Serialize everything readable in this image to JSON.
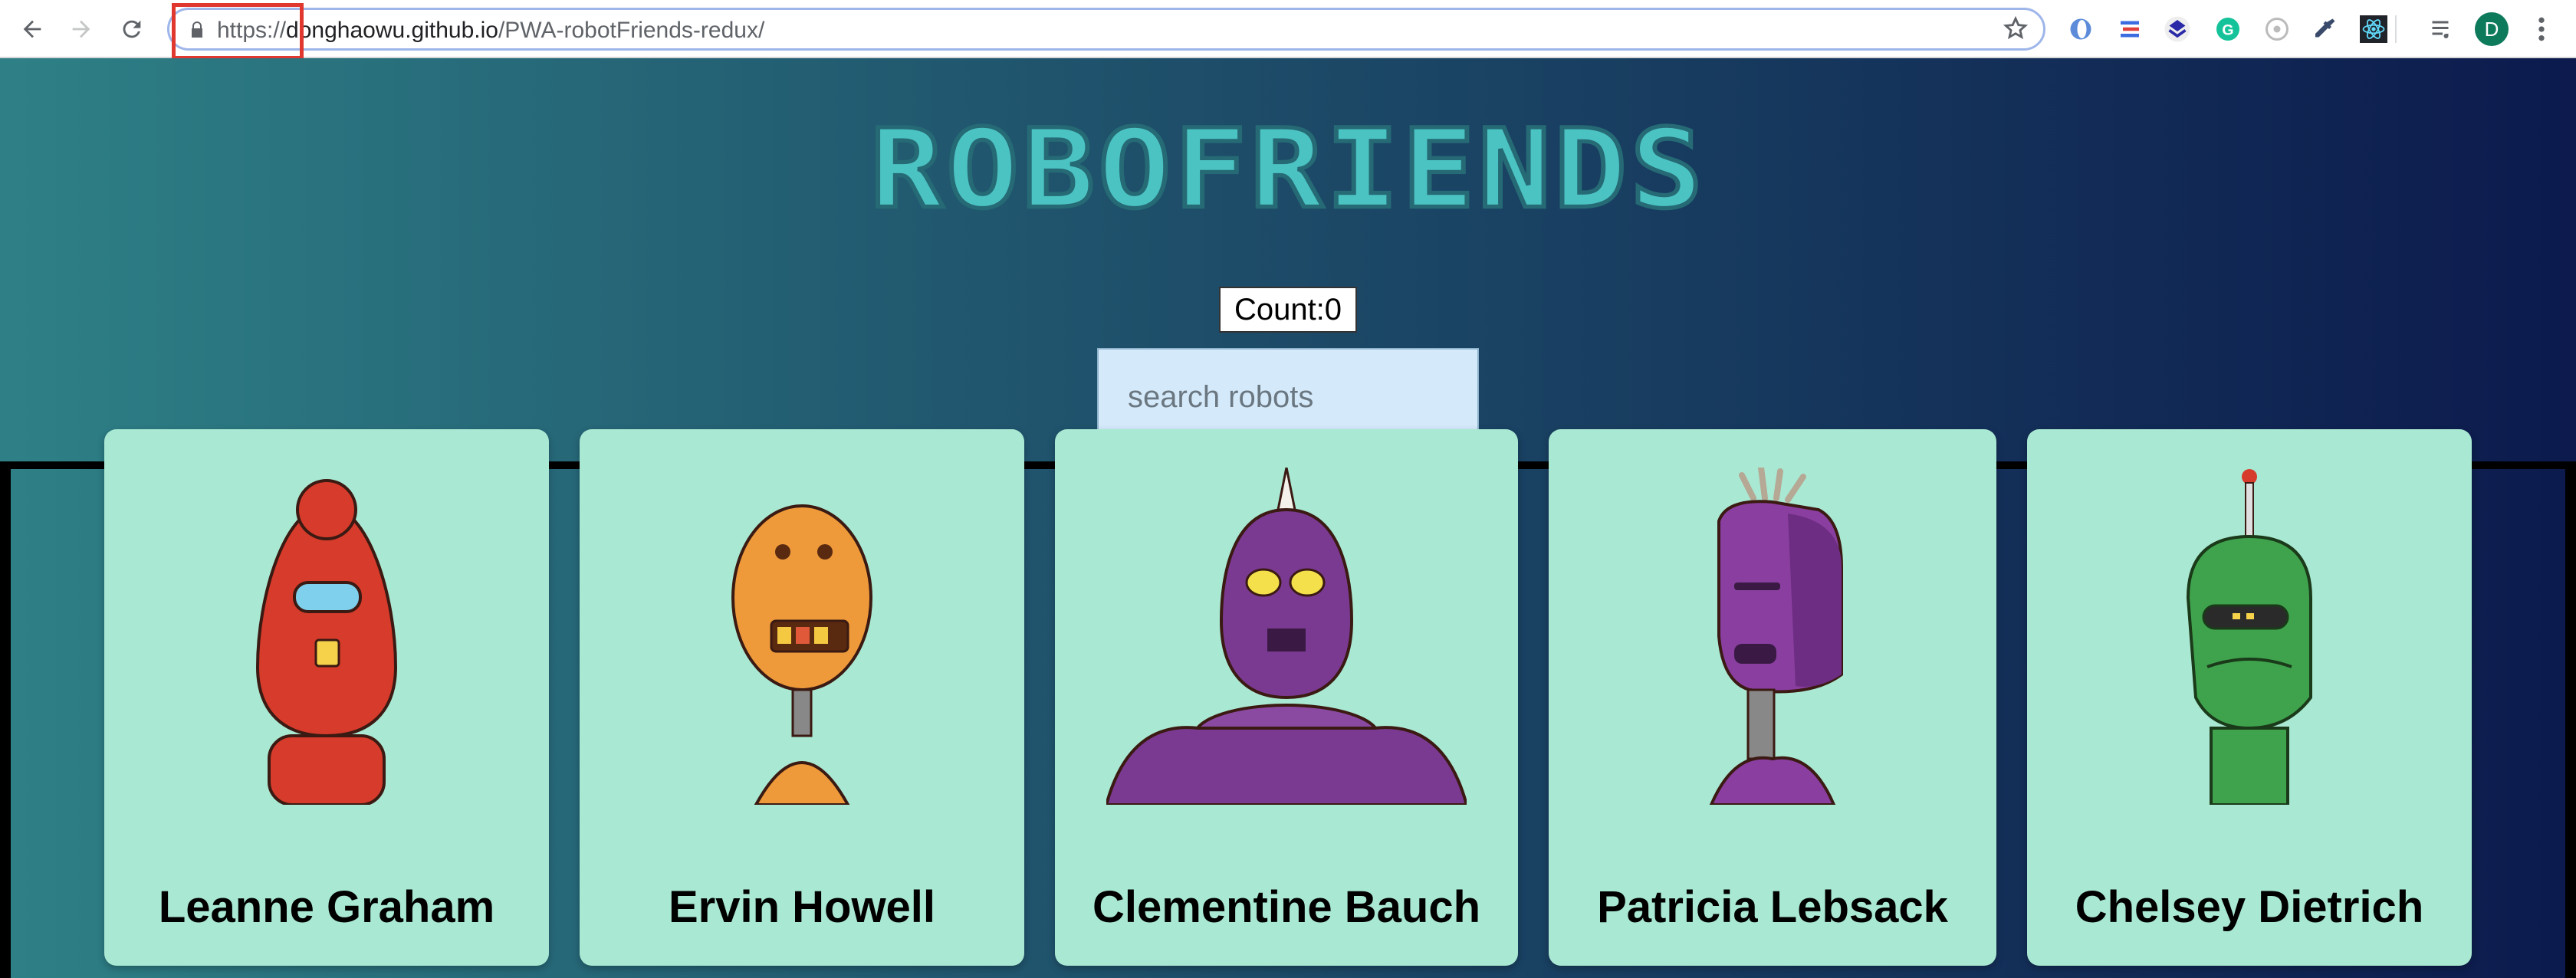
{
  "browser": {
    "url_scheme": "https://",
    "url_host": "donghaowu.github.io",
    "url_path": "/PWA-robotFriends-redux/",
    "profile_initial": "D",
    "icons": [
      "back-icon",
      "forward-icon",
      "reload-icon",
      "lock-icon",
      "star-icon",
      "menu-icon"
    ],
    "extension_icons": [
      "ext-1-icon",
      "ext-2-icon",
      "ext-3-icon",
      "grammarly-icon",
      "ext-5-icon",
      "eyedropper-icon",
      "react-icon",
      "media-control-icon"
    ]
  },
  "app": {
    "title": "ROBOFRIENDS",
    "count_label": "Count:0",
    "search_placeholder": "search robots"
  },
  "robots": [
    {
      "name": "Leanne Graham",
      "color": "#d63b2b"
    },
    {
      "name": "Ervin Howell",
      "color": "#ee9a3a"
    },
    {
      "name": "Clementine Bauch",
      "color": "#7b3a92"
    },
    {
      "name": "Patricia Lebsack",
      "color": "#8a3fa0"
    },
    {
      "name": "Chelsey Dietrich",
      "color": "#3fa34d"
    }
  ],
  "colors": {
    "title": "#4bc3c2",
    "card_bg": "#a9e8d2",
    "search_bg": "#d4eafb",
    "highlight": "#e0382e"
  }
}
